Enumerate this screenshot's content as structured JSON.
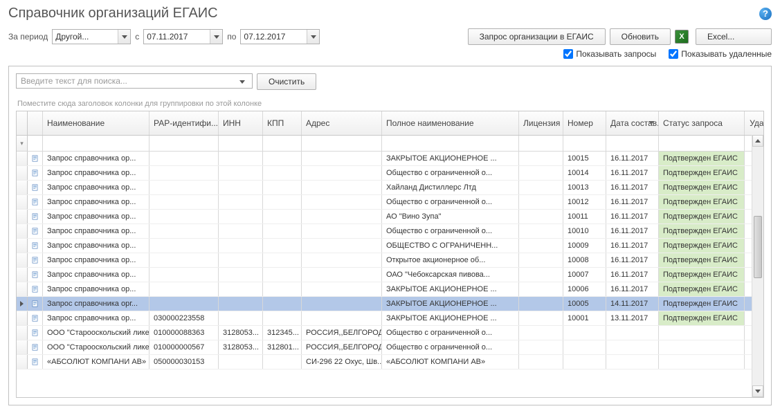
{
  "title": "Справочник организаций ЕГАИС",
  "filters": {
    "period_label": "За период",
    "period_value": "Другой...",
    "from_label": "с",
    "from_value": "07.11.2017",
    "to_label": "по",
    "to_value": "07.12.2017"
  },
  "buttons": {
    "request": "Запрос организации в ЕГАИС",
    "refresh": "Обновить",
    "excel": "Excel..."
  },
  "checkboxes": {
    "show_requests": "Показывать запросы",
    "show_deleted": "Показывать удаленные"
  },
  "search": {
    "placeholder": "Введите текст для поиска...",
    "clear": "Очистить"
  },
  "group_hint": "Поместите сюда заголовок колонки для группировки по этой колонке",
  "columns": {
    "name": "Наименование",
    "rar": "РАР-идентифи...",
    "inn": "ИНН",
    "kpp": "КПП",
    "addr": "Адрес",
    "full": "Полное наименование",
    "lic": "Лицензия",
    "num": "Номер",
    "date": "Дата состав...",
    "status": "Статус запроса",
    "del": "Удален"
  },
  "rows": [
    {
      "name": "Запрос справочника ор...",
      "rar": "",
      "inn": "",
      "kpp": "",
      "addr": "",
      "full": "ЗАКРЫТОЕ АКЦИОНЕРНОЕ ...",
      "lic": "",
      "num": "10015",
      "date": "16.11.2017",
      "status": "Подтвержден ЕГАИС",
      "sel": false
    },
    {
      "name": "Запрос справочника ор...",
      "rar": "",
      "inn": "",
      "kpp": "",
      "addr": "",
      "full": "Общество с ограниченной о...",
      "lic": "",
      "num": "10014",
      "date": "16.11.2017",
      "status": "Подтвержден ЕГАИС",
      "sel": false
    },
    {
      "name": "Запрос справочника ор...",
      "rar": "",
      "inn": "",
      "kpp": "",
      "addr": "",
      "full": "Хайланд Дистиллерс Лтд",
      "lic": "",
      "num": "10013",
      "date": "16.11.2017",
      "status": "Подтвержден ЕГАИС",
      "sel": false
    },
    {
      "name": "Запрос справочника ор...",
      "rar": "",
      "inn": "",
      "kpp": "",
      "addr": "",
      "full": "Общество с ограниченной о...",
      "lic": "",
      "num": "10012",
      "date": "16.11.2017",
      "status": "Подтвержден ЕГАИС",
      "sel": false
    },
    {
      "name": "Запрос справочника ор...",
      "rar": "",
      "inn": "",
      "kpp": "",
      "addr": "",
      "full": "АО \"Вино Зупа\"",
      "lic": "",
      "num": "10011",
      "date": "16.11.2017",
      "status": "Подтвержден ЕГАИС",
      "sel": false
    },
    {
      "name": "Запрос справочника ор...",
      "rar": "",
      "inn": "",
      "kpp": "",
      "addr": "",
      "full": "Общество с ограниченной о...",
      "lic": "",
      "num": "10010",
      "date": "16.11.2017",
      "status": "Подтвержден ЕГАИС",
      "sel": false
    },
    {
      "name": "Запрос справочника ор...",
      "rar": "",
      "inn": "",
      "kpp": "",
      "addr": "",
      "full": "ОБЩЕСТВО С ОГРАНИЧЕНН...",
      "lic": "",
      "num": "10009",
      "date": "16.11.2017",
      "status": "Подтвержден ЕГАИС",
      "sel": false
    },
    {
      "name": "Запрос справочника ор...",
      "rar": "",
      "inn": "",
      "kpp": "",
      "addr": "",
      "full": "Открытое акционерное об...",
      "lic": "",
      "num": "10008",
      "date": "16.11.2017",
      "status": "Подтвержден ЕГАИС",
      "sel": false
    },
    {
      "name": "Запрос справочника ор...",
      "rar": "",
      "inn": "",
      "kpp": "",
      "addr": "",
      "full": "ОАО \"Чебоксарская пивова...",
      "lic": "",
      "num": "10007",
      "date": "16.11.2017",
      "status": "Подтвержден ЕГАИС",
      "sel": false
    },
    {
      "name": "Запрос справочника ор...",
      "rar": "",
      "inn": "",
      "kpp": "",
      "addr": "",
      "full": "ЗАКРЫТОЕ АКЦИОНЕРНОЕ ...",
      "lic": "",
      "num": "10006",
      "date": "16.11.2017",
      "status": "Подтвержден ЕГАИС",
      "sel": false
    },
    {
      "name": "Запрос справочника орг...",
      "rar": "",
      "inn": "",
      "kpp": "",
      "addr": "",
      "full": "ЗАКРЫТОЕ АКЦИОНЕРНОЕ ...",
      "lic": "",
      "num": "10005",
      "date": "14.11.2017",
      "status": "Подтвержден ЕГАИС",
      "sel": true
    },
    {
      "name": "Запрос справочника ор...",
      "rar": "030000223558",
      "inn": "",
      "kpp": "",
      "addr": "",
      "full": "ЗАКРЫТОЕ АКЦИОНЕРНОЕ ...",
      "lic": "",
      "num": "10001",
      "date": "13.11.2017",
      "status": "Подтвержден ЕГАИС",
      "sel": false
    },
    {
      "name": "ООО \"Старооскольский лике...",
      "rar": "010000088363",
      "inn": "3128053...",
      "kpp": "312345...",
      "addr": "РОССИЯ,,БЕЛГОРОД...",
      "full": "Общество с ограниченной о...",
      "lic": "",
      "num": "",
      "date": "",
      "status": "",
      "sel": false
    },
    {
      "name": "ООО \"Старооскольский лике...",
      "rar": "010000000567",
      "inn": "3128053...",
      "kpp": "312801...",
      "addr": "РОССИЯ,,БЕЛГОРОД...",
      "full": "Общество с ограниченной о...",
      "lic": "",
      "num": "",
      "date": "",
      "status": "",
      "sel": false
    },
    {
      "name": "«АБСОЛЮТ КОМПАНИ АВ»",
      "rar": "050000030153",
      "inn": "",
      "kpp": "",
      "addr": "СИ-296 22 Охус, Шв...",
      "full": "«АБСОЛЮТ КОМПАНИ АВ»",
      "lic": "",
      "num": "",
      "date": "",
      "status": "",
      "sel": false
    }
  ]
}
